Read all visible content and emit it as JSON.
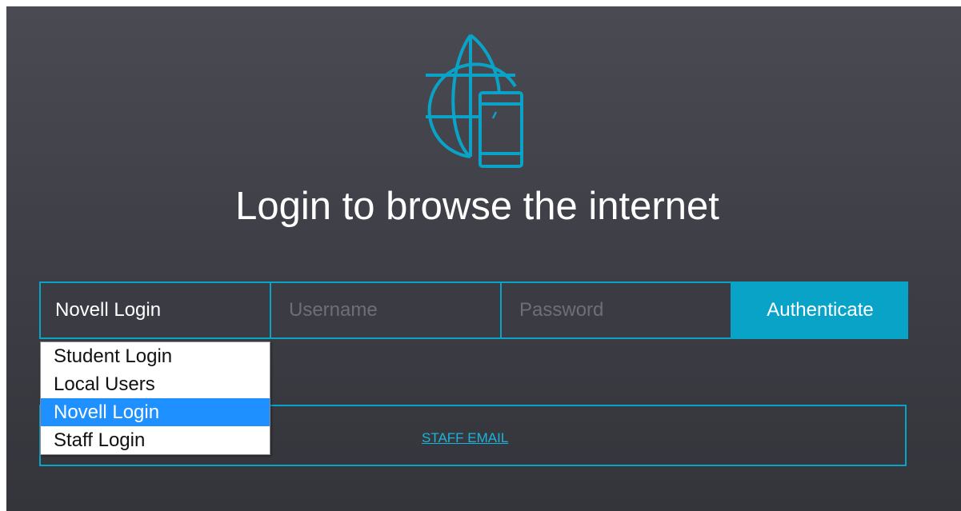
{
  "colors": {
    "accent": "#0aa3c8",
    "background": "#3d3d45",
    "selected_option": "#1e90ff",
    "text": "#ffffff"
  },
  "logo": {
    "icon": "globe-with-phone-icon"
  },
  "title": "Login to browse the internet",
  "form": {
    "login_type_value": "Novell Login",
    "username_placeholder": "Username",
    "password_placeholder": "Password",
    "submit_label": "Authenticate"
  },
  "dropdown": {
    "options": [
      "Student Login",
      "Local Users",
      "Novell Login",
      "Staff Login"
    ],
    "selected": "Novell Login"
  },
  "links": {
    "staff_email": "STAFF EMAIL"
  }
}
